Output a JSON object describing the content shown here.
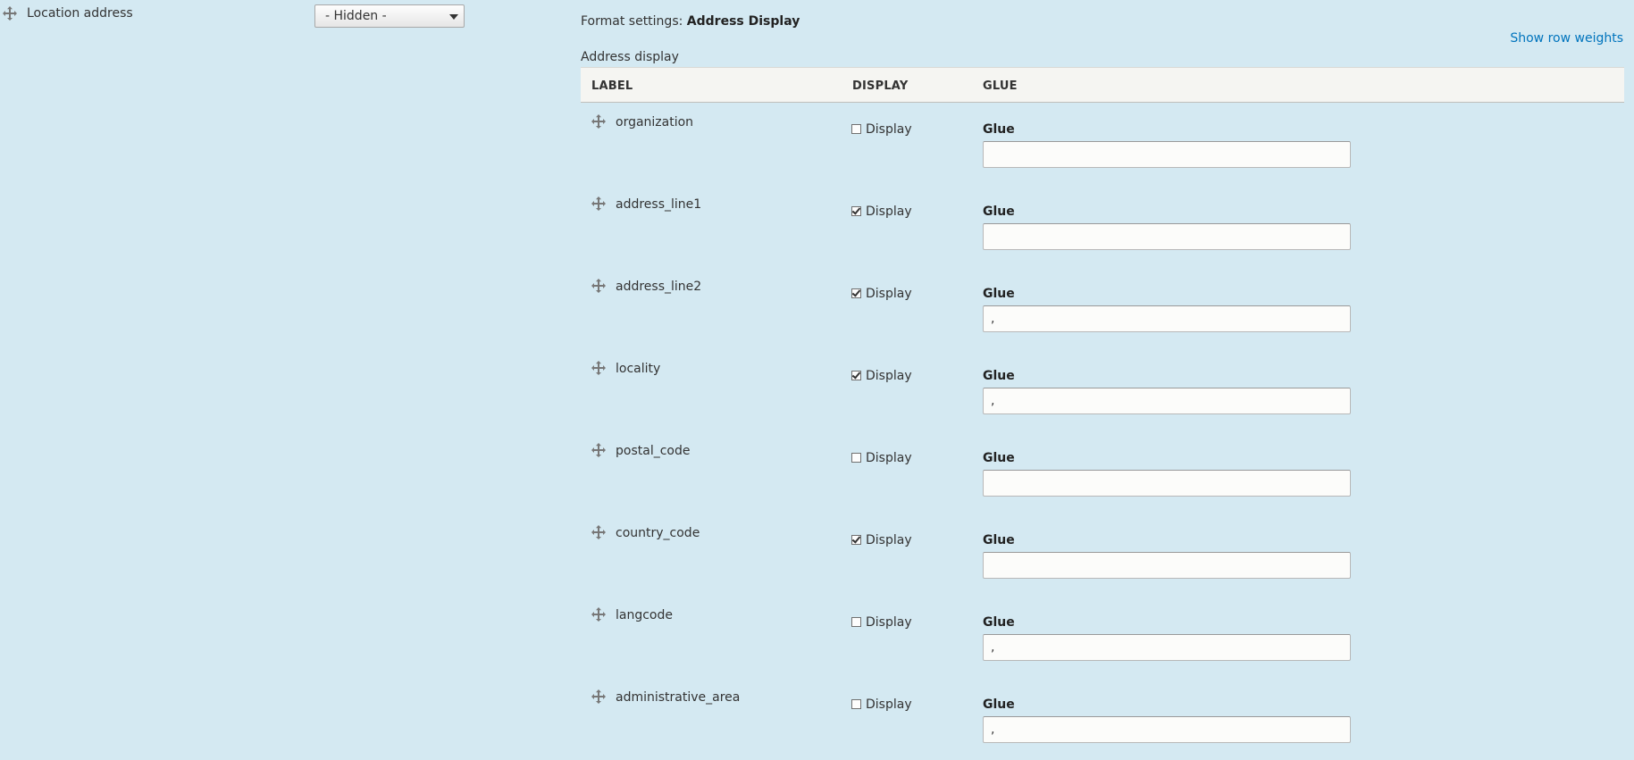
{
  "field": {
    "label": "Location address",
    "drag_icon": "move-arrows-icon",
    "format_select_value": "- Hidden -"
  },
  "format_settings": {
    "prefix": "Format settings:",
    "name": "Address Display"
  },
  "show_row_weights": "Show row weights",
  "table": {
    "caption": "Address display",
    "headers": {
      "label": "LABEL",
      "display": "DISPLAY",
      "glue": "GLUE"
    },
    "rows": [
      {
        "label": "organization",
        "display_checked": false,
        "display_text": "Display",
        "glue_label": "Glue",
        "glue_value": ""
      },
      {
        "label": "address_line1",
        "display_checked": true,
        "display_text": "Display",
        "glue_label": "Glue",
        "glue_value": ""
      },
      {
        "label": "address_line2",
        "display_checked": true,
        "display_text": "Display",
        "glue_label": "Glue",
        "glue_value": ","
      },
      {
        "label": "locality",
        "display_checked": true,
        "display_text": "Display",
        "glue_label": "Glue",
        "glue_value": ","
      },
      {
        "label": "postal_code",
        "display_checked": false,
        "display_text": "Display",
        "glue_label": "Glue",
        "glue_value": ""
      },
      {
        "label": "country_code",
        "display_checked": true,
        "display_text": "Display",
        "glue_label": "Glue",
        "glue_value": ""
      },
      {
        "label": "langcode",
        "display_checked": false,
        "display_text": "Display",
        "glue_label": "Glue",
        "glue_value": ","
      },
      {
        "label": "administrative_area",
        "display_checked": false,
        "display_text": "Display",
        "glue_label": "Glue",
        "glue_value": ","
      }
    ]
  },
  "colors": {
    "background": "#d4e9f2",
    "link": "#0074bd",
    "header_bg": "#f5f5f2"
  }
}
